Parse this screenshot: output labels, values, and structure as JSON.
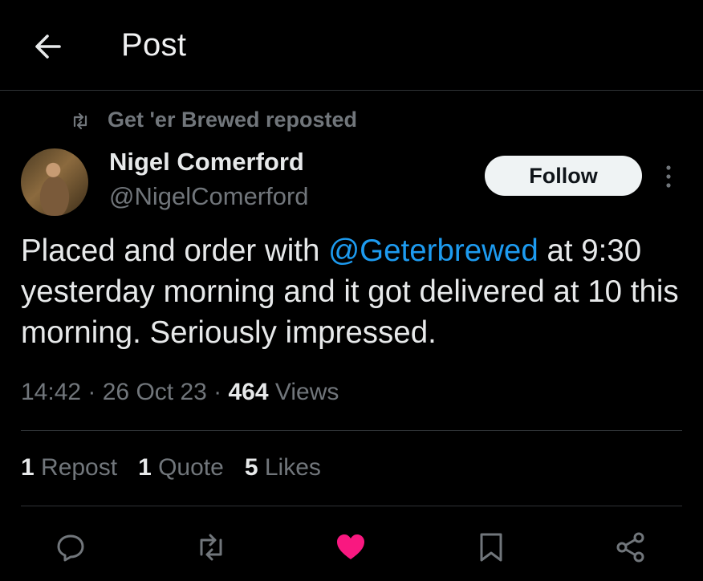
{
  "header": {
    "title": "Post"
  },
  "repost_banner": {
    "text": "Get 'er Brewed reposted"
  },
  "author": {
    "name": "Nigel Comerford",
    "handle": "@NigelComerford",
    "follow_label": "Follow"
  },
  "tweet": {
    "text_before": "Placed and order with ",
    "mention": "@Geterbrewed",
    "text_after": " at 9:30 yesterday morning and it got delivered at 10 this morning. Seriously impressed."
  },
  "meta": {
    "time": "14:42",
    "sep1": " · ",
    "date": "26 Oct 23",
    "sep2": " · ",
    "views_count": "464",
    "views_label": " Views"
  },
  "stats": {
    "reposts_count": "1",
    "reposts_label": " Repost",
    "quotes_count": "1",
    "quotes_label": " Quote",
    "likes_count": "5",
    "likes_label": " Likes"
  },
  "actions": {
    "icons": [
      "reply-icon",
      "repost-icon",
      "like-icon",
      "bookmark-icon",
      "share-icon"
    ],
    "like_color": "#f91880"
  },
  "colors": {
    "accent": "#1d9bf0",
    "muted": "#71767b",
    "divider": "#2f3336"
  }
}
